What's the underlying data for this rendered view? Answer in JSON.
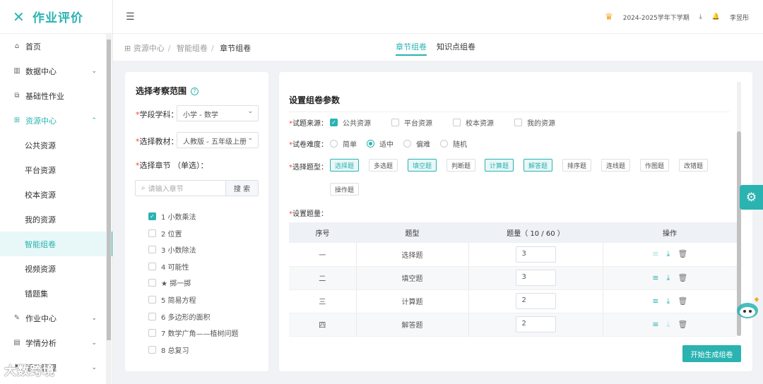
{
  "brand": {
    "logo_icon": "x-logo-icon",
    "name": "作业评价",
    "accent": "#2ab3b1"
  },
  "sidebar": {
    "items": [
      {
        "label": "首页",
        "icon": "home-icon"
      },
      {
        "label": "数据中心",
        "icon": "bar-chart-icon",
        "arrow": "chevron-down-icon"
      },
      {
        "label": "基础性作业",
        "icon": "copy-icon"
      },
      {
        "label": "资源中心",
        "icon": "grid-icon",
        "arrow": "chevron-up-icon"
      },
      {
        "label": "公共资源"
      },
      {
        "label": "平台资源"
      },
      {
        "label": "校本资源"
      },
      {
        "label": "我的资源"
      },
      {
        "label": "智能组卷"
      },
      {
        "label": "视频资源"
      },
      {
        "label": "错题集"
      },
      {
        "label": "作业中心",
        "icon": "edit-icon",
        "arrow": "chevron-down-icon"
      },
      {
        "label": "学情分析",
        "icon": "report-icon",
        "arrow": "chevron-down-icon"
      },
      {
        "label": "活动管理",
        "icon": "flag-icon",
        "arrow": "chevron-down-icon"
      }
    ]
  },
  "topbar": {
    "semester": "2024-2025学年下学期",
    "user": "李昱彤"
  },
  "breadcrumb": {
    "items": [
      "资源中心",
      "智能组卷",
      "章节组卷"
    ]
  },
  "tabs": [
    "章节组卷",
    "知识点组卷"
  ],
  "left": {
    "title": "选择考察范围",
    "help": "?",
    "subject_label": "学段学科：",
    "subject_value": "小学 - 数学",
    "textbook_label": "选择教材：",
    "textbook_value": "人教版 - 五年级上册",
    "chapter_label": "选择章节 （单选）：",
    "search_placeholder": "请输入章节",
    "search_button": "搜 索",
    "chapters": [
      {
        "label": "1 小数乘法",
        "checked": true
      },
      {
        "label": "2 位置",
        "checked": false
      },
      {
        "label": "3 小数除法",
        "checked": false
      },
      {
        "label": "4 可能性",
        "checked": false
      },
      {
        "label": "★ 掷一掷",
        "checked": false
      },
      {
        "label": "5 简易方程",
        "checked": false
      },
      {
        "label": "6 多边形的面积",
        "checked": false
      },
      {
        "label": "7 数学广角——植树问题",
        "checked": false
      },
      {
        "label": "8 总复习",
        "checked": false
      }
    ]
  },
  "right": {
    "title": "设置组卷参数",
    "source_label": "试题来源：",
    "sources": [
      {
        "label": "公共资源",
        "checked": true
      },
      {
        "label": "平台资源",
        "checked": false
      },
      {
        "label": "校本资源",
        "checked": false
      },
      {
        "label": "我的资源",
        "checked": false
      }
    ],
    "difficulty_label": "试卷难度：",
    "difficulties": [
      {
        "label": "简单",
        "checked": false
      },
      {
        "label": "适中",
        "checked": true
      },
      {
        "label": "偏难",
        "checked": false
      },
      {
        "label": "随机",
        "checked": false
      }
    ],
    "qtype_label": "选择题型：",
    "qtypes": [
      {
        "label": "选择题",
        "on": true
      },
      {
        "label": "多选题",
        "on": false
      },
      {
        "label": "填空题",
        "on": true
      },
      {
        "label": "判断题",
        "on": false
      },
      {
        "label": "计算题",
        "on": true
      },
      {
        "label": "解答题",
        "on": true
      },
      {
        "label": "排序题",
        "on": false
      },
      {
        "label": "连线题",
        "on": false
      },
      {
        "label": "作图题",
        "on": false
      },
      {
        "label": "改错题",
        "on": false
      },
      {
        "label": "操作题",
        "on": false
      }
    ],
    "count_label": "设置题量：",
    "table": {
      "headers": [
        "序号",
        "题型",
        "题量（ 10 / 60 ）",
        "操作"
      ],
      "rows": [
        {
          "index": "一",
          "type": "选择题",
          "count": "3"
        },
        {
          "index": "二",
          "type": "填空题",
          "count": "3"
        },
        {
          "index": "三",
          "type": "计算题",
          "count": "2"
        },
        {
          "index": "四",
          "type": "解答题",
          "count": "2"
        }
      ]
    },
    "generate_button": "开始生成组卷"
  },
  "watermark": "大数跨境"
}
